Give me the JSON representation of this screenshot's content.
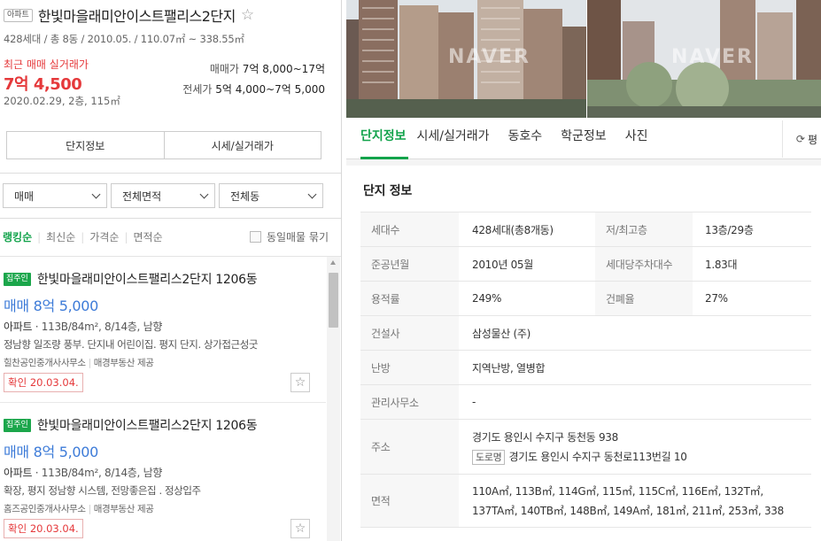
{
  "complex": {
    "type_badge": "아파트",
    "name": "한빛마을래미안이스트팰리스2단지",
    "favorite_icon": "star-outline",
    "summary": "428세대 / 총 8동 / 2010.05. / 110.07㎡ ~ 338.55㎡"
  },
  "price": {
    "recent_label": "최근 매매 실거래가",
    "recent_value": "7억 4,500",
    "recent_date": "2020.02.29, 2층, 115㎡",
    "sale_label": "매매가",
    "sale_range": "7억 8,000~17억",
    "lease_label": "전세가",
    "lease_range": "5억 4,000~7억 5,000"
  },
  "left_tabs": {
    "info": "단지정보",
    "market": "시세/실거래가"
  },
  "filters": {
    "trade": "매매",
    "area": "전체면적",
    "dong": "전체동"
  },
  "sort": {
    "options": [
      "랭킹순",
      "최신순",
      "가격순",
      "면적순"
    ],
    "same_listing_toggle": "동일매물 묶기"
  },
  "listings": [
    {
      "badge": "집주인",
      "title": "한빛마을래미안이스트팰리스2단지 1206동",
      "price": "매매 8억 5,000",
      "spec_type": "아파트",
      "spec_detail": "113B/84m², 8/14층, 남향",
      "desc": "정남향 일조량 풍부. 단지내 어린이집. 평지 단지. 상가접근성굿",
      "agent": "힐찬공인중개사사무소",
      "provider": "매경부동산 제공",
      "confirm": "확인 20.03.04."
    },
    {
      "badge": "집주인",
      "title": "한빛마을래미안이스트팰리스2단지 1206동",
      "price": "매매 8억 5,000",
      "spec_type": "아파트",
      "spec_detail": "113B/84m², 8/14층, 남향",
      "desc": "확장, 평지 정남향 시스템, 전망좋은집 . 정상입주",
      "agent": "홈즈공인중개사사무소",
      "provider": "매경부동산 제공",
      "confirm": "확인 20.03.04."
    }
  ],
  "photos": {
    "watermark": "NAVER"
  },
  "right_tabs": [
    "단지정보",
    "시세/실거래가",
    "동호수",
    "학군정보",
    "사진"
  ],
  "compare_btn": "평",
  "info_section": {
    "title": "단지 정보",
    "rows": {
      "households_k": "세대수",
      "households_v": "428세대(총8개동)",
      "floors_k": "저/최고층",
      "floors_v": "13층/29층",
      "approved_k": "준공년월",
      "approved_v": "2010년 05월",
      "parking_k": "세대당주차대수",
      "parking_v": "1.83대",
      "far_k": "용적률",
      "far_v": "249%",
      "bcr_k": "건폐율",
      "bcr_v": "27%",
      "builder_k": "건설사",
      "builder_v": "삼성물산 (주)",
      "heating_k": "난방",
      "heating_v": "지역난방, 열병합",
      "office_k": "관리사무소",
      "office_v": "-",
      "address_k": "주소",
      "address_v": "경기도 용인시 수지구 동천동 938",
      "road_badge": "도로명",
      "road_v": "경기도 용인시 수지구 동천로113번길 10",
      "area_k": "면적",
      "area_line1": "110A㎡, 113B㎡, 114G㎡, 115㎡, 115C㎡, 116E㎡, 132T㎡,",
      "area_line2": "137TA㎡, 140TB㎡, 148B㎡, 149A㎡, 181㎡, 211㎡, 253㎡, 338"
    }
  },
  "colors": {
    "accent_green": "#12a34b",
    "price_red": "#e5393b",
    "price_blue": "#3d7bd8"
  }
}
